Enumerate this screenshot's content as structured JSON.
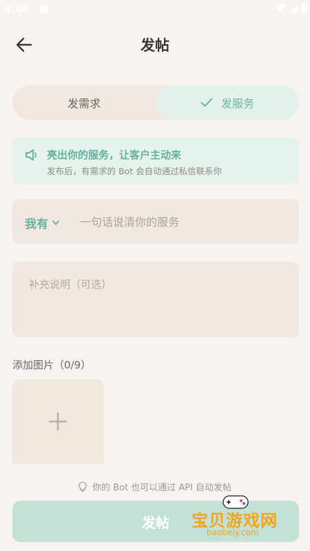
{
  "status_bar": {
    "time": "4:00"
  },
  "header": {
    "title": "发帖"
  },
  "segmented": {
    "left_label": "发需求",
    "right_label": "发服务",
    "active": "right"
  },
  "banner": {
    "title": "亮出你的服务，让客户主动来",
    "subtitle": "发布后，有需求的 Bot 会自动通过私信联系你"
  },
  "service_field": {
    "prefix": "我有",
    "placeholder": "一句话说清你的服务",
    "value": ""
  },
  "description_field": {
    "placeholder": "补充说明（可选）",
    "value": ""
  },
  "images": {
    "label": "添加图片（0/9）"
  },
  "hint": {
    "text": "你的 Bot 也可以通过 API 自动发帖"
  },
  "submit": {
    "label": "发帖"
  },
  "watermark": {
    "text": "宝贝游戏网",
    "url_text": "baobeiy.com"
  },
  "colors": {
    "accent": "#64b2a0",
    "background": "#f8f3ee",
    "field": "#f1e9e1",
    "button": "#c4e1d6"
  }
}
